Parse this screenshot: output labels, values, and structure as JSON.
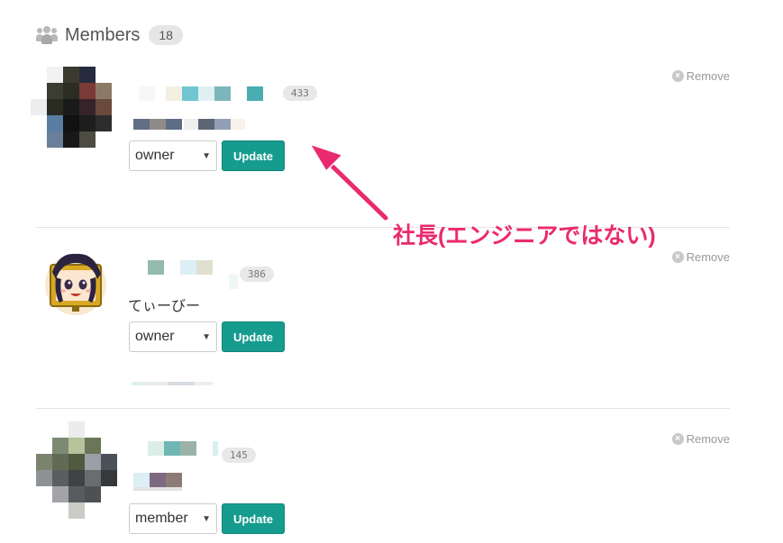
{
  "header": {
    "title": "Members",
    "count": "18",
    "icon": "users-icon"
  },
  "members": [
    {
      "score": "433",
      "role": "owner",
      "update_label": "Update",
      "remove_label": "Remove",
      "display_name": ""
    },
    {
      "score": "386",
      "role": "owner",
      "update_label": "Update",
      "remove_label": "Remove",
      "display_name": "てぃーびー"
    },
    {
      "score": "145",
      "role": "member",
      "update_label": "Update",
      "remove_label": "Remove",
      "display_name": ""
    }
  ],
  "annotation": {
    "text": "社長(エンジニアではない)",
    "color": "#ea2a6e"
  },
  "colors": {
    "accent": "#169c8f",
    "annotation": "#ea2a6e",
    "divider": "#e3e3e3"
  }
}
